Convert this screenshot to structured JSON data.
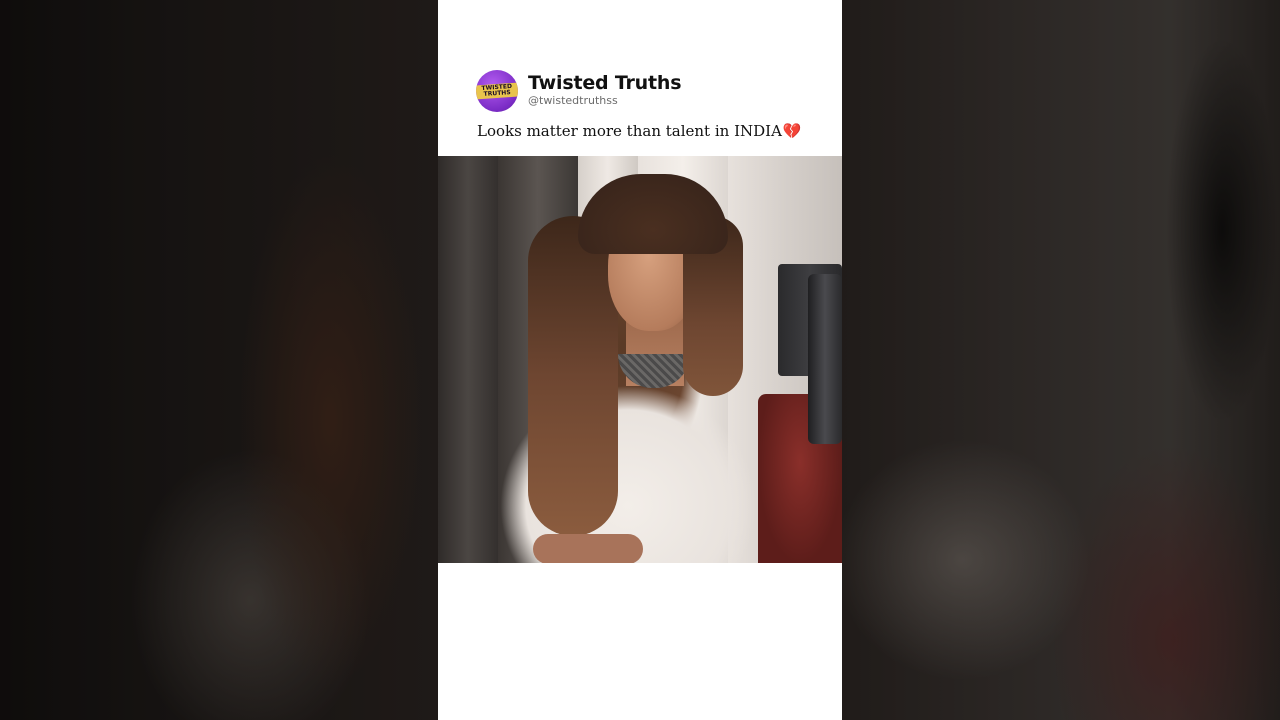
{
  "post": {
    "account_name": "Twisted Truths",
    "account_handle": "@twistedtruthss",
    "avatar_text": "TWISTED TRUTHS",
    "caption": "Looks matter more than talent in INDIA",
    "caption_emoji": "💔",
    "media": {
      "type": "video-frame",
      "description_icon": "person-image"
    }
  },
  "colors": {
    "avatar_bg": "#8a3fd6",
    "heart": "#e0314b",
    "card_bg": "#ffffff"
  }
}
